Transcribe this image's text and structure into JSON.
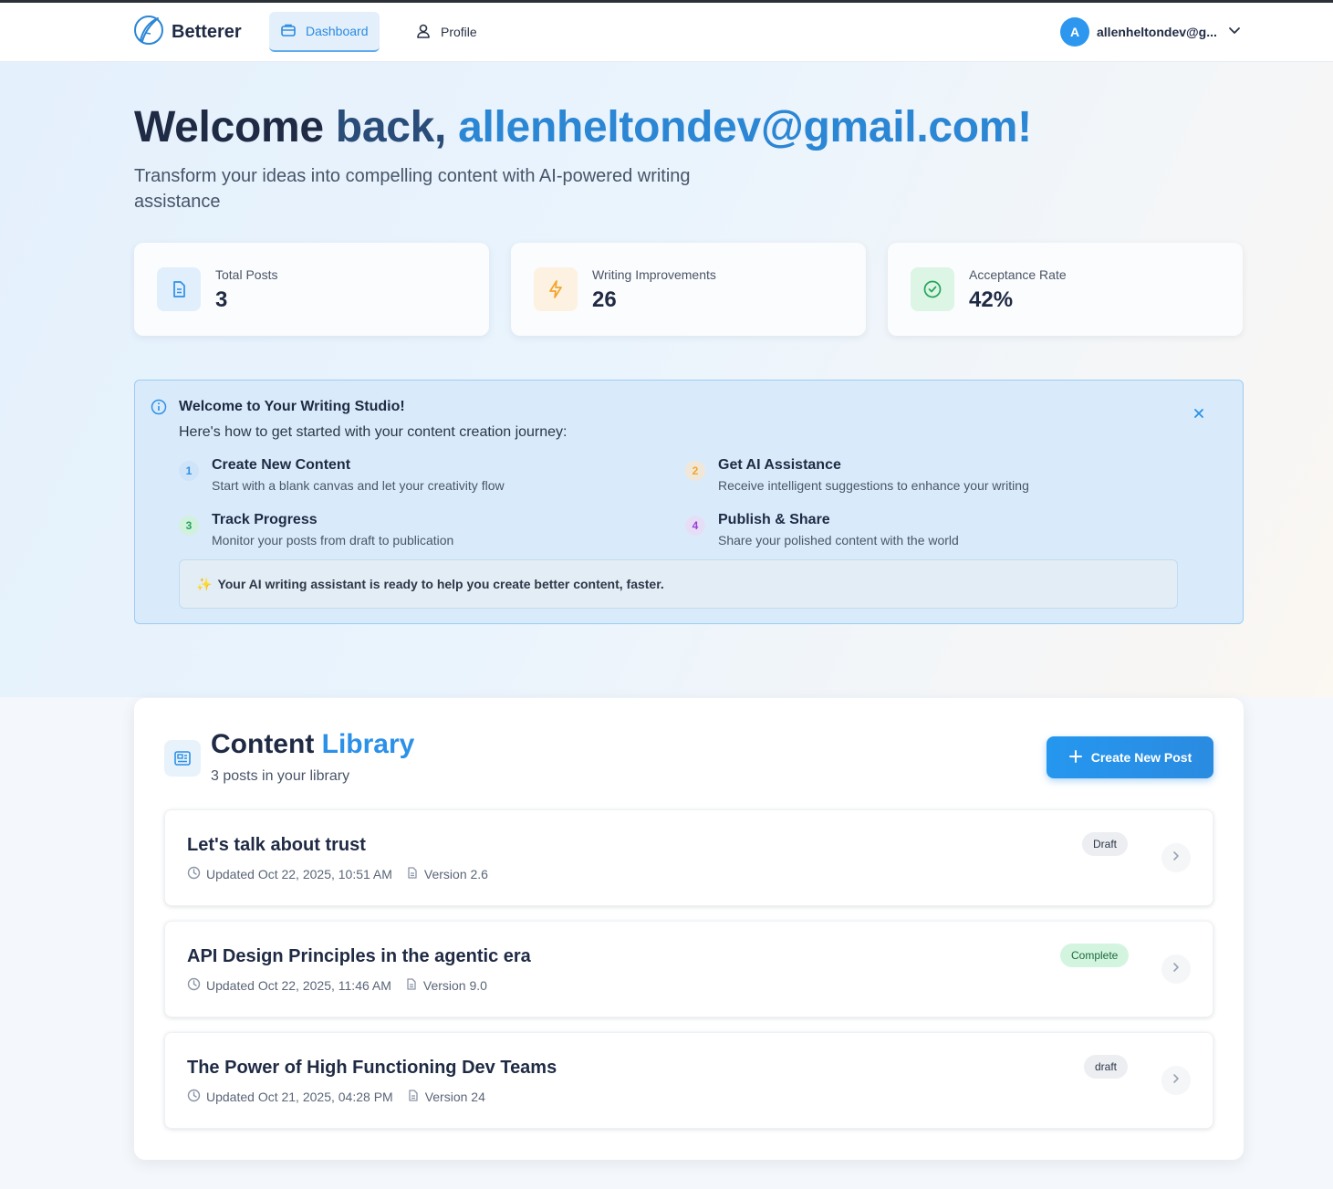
{
  "nav": {
    "brand": "Betterer",
    "tabs": [
      {
        "label": "Dashboard",
        "icon": "briefcase-icon",
        "active": true
      },
      {
        "label": "Profile",
        "icon": "user-icon",
        "active": false
      }
    ],
    "user": {
      "initial": "A",
      "email": "allenheltondev@g..."
    }
  },
  "hero": {
    "title_prefix": "Welcome ",
    "title_back": "back, ",
    "title_email": "allenheltondev@gmail.com!",
    "subtitle": "Transform your ideas into compelling content with AI-powered writing assistance"
  },
  "stats": [
    {
      "label": "Total Posts",
      "value": "3",
      "icon": "document-icon",
      "color": "#2b90e8"
    },
    {
      "label": "Writing Improvements",
      "value": "26",
      "icon": "lightning-icon",
      "color": "#f3a52a"
    },
    {
      "label": "Acceptance Rate",
      "value": "42%",
      "icon": "check-circle-icon",
      "color": "#23a55a"
    }
  ],
  "welcome": {
    "title": "Welcome to Your Writing Studio!",
    "subtitle": "Here's how to get started with your content creation journey:",
    "steps": [
      {
        "num": "1",
        "title": "Create New Content",
        "desc": "Start with a blank canvas and let your creativity flow",
        "color": "#2b90e8"
      },
      {
        "num": "2",
        "title": "Get AI Assistance",
        "desc": "Receive intelligent suggestions to enhance your writing",
        "color": "#f3a52a"
      },
      {
        "num": "3",
        "title": "Track Progress",
        "desc": "Monitor your posts from draft to publication",
        "color": "#23a55a"
      },
      {
        "num": "4",
        "title": "Publish & Share",
        "desc": "Share your polished content with the world",
        "color": "#9b3ed6"
      }
    ],
    "tip_icon": "✨",
    "tip": "Your AI writing assistant is ready to help you create better content, faster."
  },
  "library": {
    "title_a": "Content ",
    "title_b": "Library",
    "subtitle": "3 posts in your library",
    "create_label": "Create New Post",
    "posts": [
      {
        "title": "Let's talk about trust",
        "updated": "Updated Oct 22, 2025, 10:51 AM",
        "version": "Version 2.6",
        "status": "Draft"
      },
      {
        "title": "API Design Principles in the agentic era",
        "updated": "Updated Oct 22, 2025, 11:46 AM",
        "version": "Version 9.0",
        "status": "Complete"
      },
      {
        "title": "The Power of High Functioning Dev Teams",
        "updated": "Updated Oct 21, 2025, 04:28 PM",
        "version": "Version 24",
        "status": "draft"
      }
    ]
  }
}
